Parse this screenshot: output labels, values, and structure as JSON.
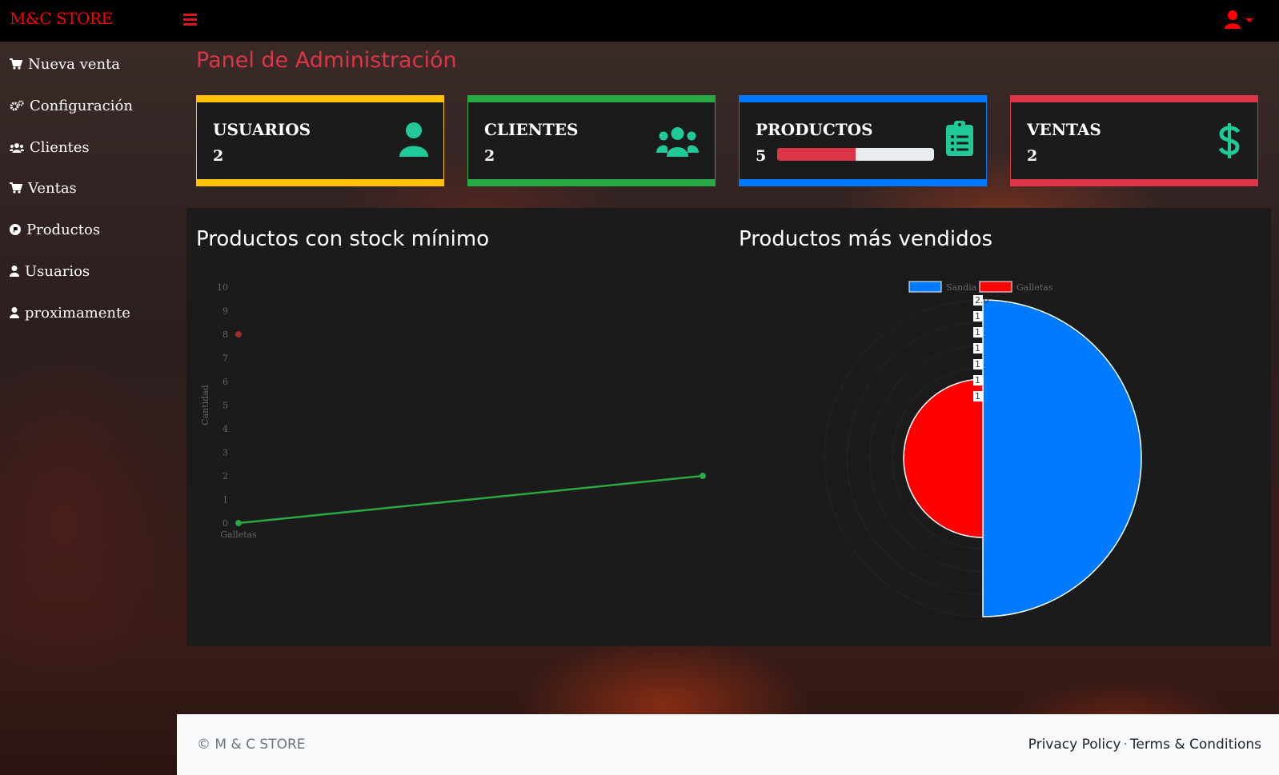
{
  "brand": "M&C STORE",
  "sidebar": {
    "items": [
      {
        "label": "Nueva venta"
      },
      {
        "label": "Configuración"
      },
      {
        "label": "Clientes"
      },
      {
        "label": "Ventas"
      },
      {
        "label": "Productos"
      },
      {
        "label": "Usuarios"
      },
      {
        "label": "proximamente"
      }
    ]
  },
  "page_title": "Panel de Administración",
  "cards": [
    {
      "title": "USUARIOS",
      "value": "2",
      "color": "#ffc107",
      "icon": "user-icon"
    },
    {
      "title": "CLIENTES",
      "value": "2",
      "color": "#28a745",
      "icon": "users-icon"
    },
    {
      "title": "PRODUCTOS",
      "value": "5",
      "color": "#007bff",
      "icon": "clipboard-list-icon",
      "progress": 0.5
    },
    {
      "title": "VENTAS",
      "value": "2",
      "color": "#dc3545",
      "icon": "dollar-icon"
    }
  ],
  "icon_color": "#20c997",
  "chart_data": [
    {
      "type": "line",
      "title": "Productos con stock mínimo",
      "ylabel": "Cantidad",
      "xlabel": "",
      "categories": [
        "Galletas",
        ""
      ],
      "ylim": [
        0,
        10
      ],
      "yticks": [
        "0",
        "1",
        "2",
        "3",
        "4",
        "5",
        "6",
        "7",
        "8",
        "9",
        "10"
      ],
      "series": [
        {
          "values": [
            0,
            2
          ],
          "color": "#28a745"
        }
      ],
      "extra_point": {
        "y": 8,
        "color": "#a52a2a"
      },
      "grid": false
    },
    {
      "type": "pie",
      "title": "Productos más vendidos",
      "legend_position": "top",
      "slices": [
        {
          "name": "Sandia",
          "value": 2,
          "color": "#007bff"
        },
        {
          "name": "Galletas",
          "value": 1,
          "color": "#ff0000"
        }
      ],
      "scale_labels": [
        "2.0",
        "1",
        "1",
        "1",
        "1",
        "1",
        "1"
      ]
    }
  ],
  "footer": {
    "copyright": "© M & C STORE",
    "privacy": "Privacy Policy",
    "separator": "·",
    "terms": "Terms & Conditions"
  }
}
